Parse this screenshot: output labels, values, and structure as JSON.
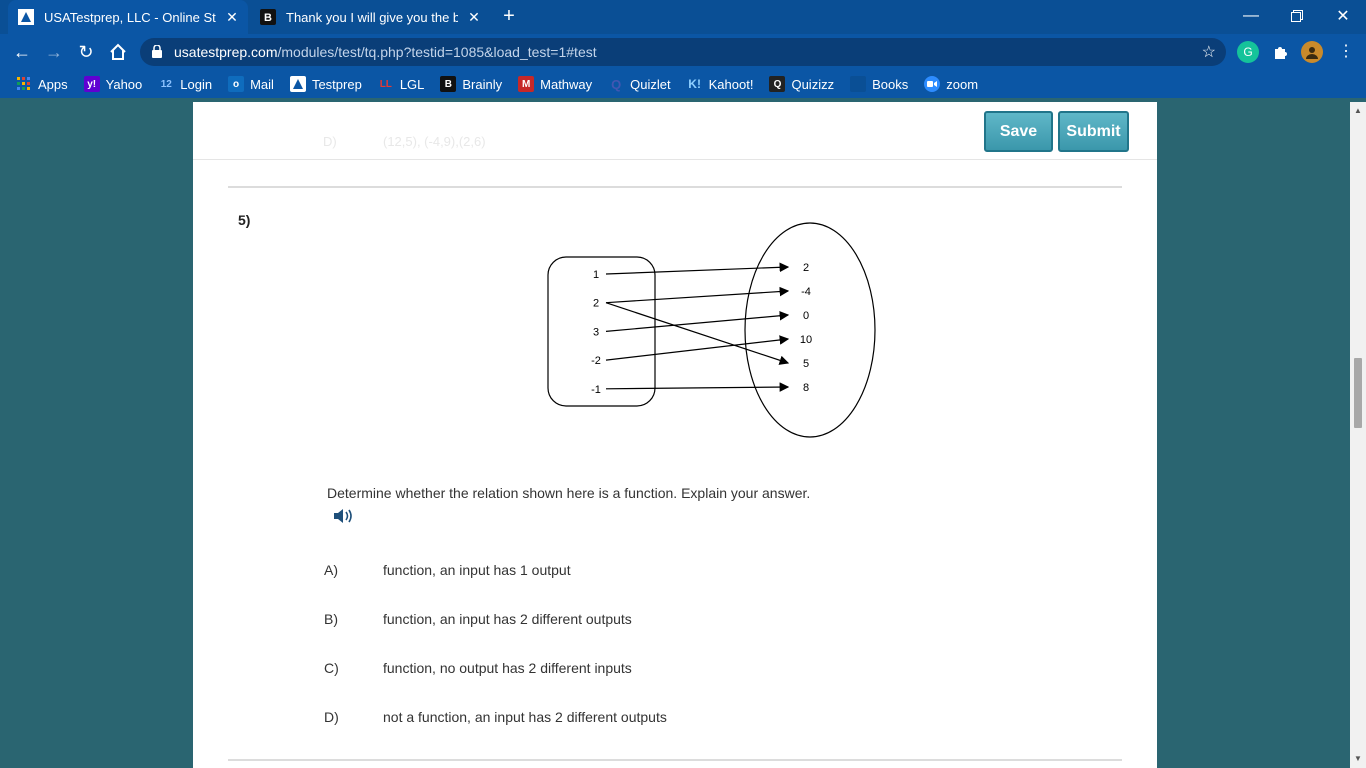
{
  "browser": {
    "tabs": [
      {
        "title": "USATestprep, LLC - Online State-",
        "active": true
      },
      {
        "title": "Thank you I will give you the brai",
        "active": false
      }
    ],
    "url_host": "usatestprep.com",
    "url_path": "/modules/test/tq.php?testid=1085&load_test=1#test",
    "bookmarks": [
      {
        "label": "Apps",
        "icon": "apps-grid-icon"
      },
      {
        "label": "Yahoo",
        "icon": "yahoo-icon"
      },
      {
        "label": "Login",
        "icon": "login-12-icon"
      },
      {
        "label": "Mail",
        "icon": "outlook-icon"
      },
      {
        "label": "Testprep",
        "icon": "testprep-icon"
      },
      {
        "label": "LGL",
        "icon": "lgl-icon"
      },
      {
        "label": "Brainly",
        "icon": "brainly-icon"
      },
      {
        "label": "Mathway",
        "icon": "mathway-icon"
      },
      {
        "label": "Quizlet",
        "icon": "quizlet-icon"
      },
      {
        "label": "Kahoot!",
        "icon": "kahoot-icon"
      },
      {
        "label": "Quizizz",
        "icon": "quizizz-icon"
      },
      {
        "label": "Books",
        "icon": "books-icon"
      },
      {
        "label": "zoom",
        "icon": "zoom-icon"
      }
    ]
  },
  "header": {
    "prev_choice_letter": "D)",
    "prev_choice_text": "(12,5), (-4,9),(2,6)",
    "save_label": "Save",
    "submit_label": "Submit"
  },
  "question": {
    "number": "5)",
    "inputs": [
      "1",
      "2",
      "3",
      "-2",
      "-1"
    ],
    "outputs": [
      "2",
      "-4",
      "0",
      "10",
      "5",
      "8"
    ],
    "mappings": [
      [
        "1",
        "2"
      ],
      [
        "2",
        "-4"
      ],
      [
        "2",
        "5"
      ],
      [
        "3",
        "0"
      ],
      [
        "-2",
        "10"
      ],
      [
        "-1",
        "8"
      ]
    ],
    "prompt": "Determine whether the relation shown here is a function. Explain your answer.",
    "choices": [
      {
        "letter": "A)",
        "text": "function, an input has 1 output"
      },
      {
        "letter": "B)",
        "text": "function, an input has 2 different outputs"
      },
      {
        "letter": "C)",
        "text": "function, no output has 2 different inputs"
      },
      {
        "letter": "D)",
        "text": "not a function, an input has 2 different outputs"
      }
    ]
  },
  "colors": {
    "chrome_blue": "#0b56a5",
    "page_teal": "#2a6571",
    "button_teal": "#3b97ab"
  }
}
